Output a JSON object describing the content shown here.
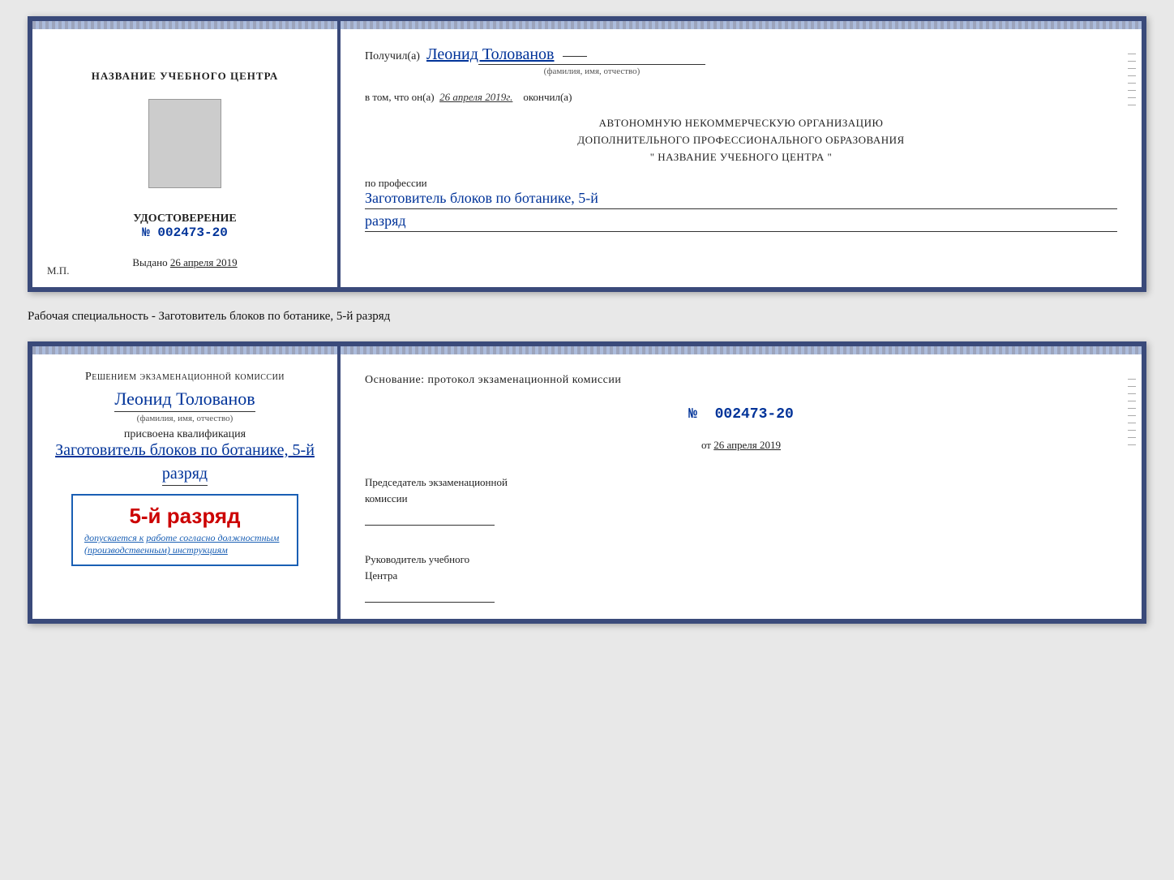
{
  "doc1": {
    "left": {
      "center_title": "НАЗВАНИЕ УЧЕБНОГО ЦЕНТРА",
      "udostoverenie_label": "УДОСТОВЕРЕНИЕ",
      "number_prefix": "№",
      "number": "002473-20",
      "vydano_label": "Выдано",
      "vydano_date": "26 апреля 2019",
      "mp_label": "М.П."
    },
    "right": {
      "poluchil_prefix": "Получил(а)",
      "recipient_name": "Леонид Толованов",
      "fio_hint": "(фамилия, имя, отчество)",
      "vtom_prefix": "в том, что он(а)",
      "vtom_date": "26 апреля 2019г.",
      "okonchil": "окончил(а)",
      "avtonomnuyu_line1": "АВТОНОМНУЮ НЕКОММЕРЧЕСКУЮ ОРГАНИЗАЦИЮ",
      "avtonomnuyu_line2": "ДОПОЛНИТЕЛЬНОГО ПРОФЕССИОНАЛЬНОГО ОБРАЗОВАНИЯ",
      "nazvanie_label": "\" НАЗВАНИЕ УЧЕБНОГО ЦЕНТРА \"",
      "po_professii": "по профессии",
      "profession": "Заготовитель блоков по ботанике, 5-й",
      "razryad": "разряд"
    }
  },
  "specialty_label": "Рабочая специальность - Заготовитель блоков по ботанике, 5-й разряд",
  "doc2": {
    "left": {
      "resheniem_label": "Решением экзаменационной комиссии",
      "recipient_name": "Леонид Толованов",
      "fio_hint": "(фамилия, имя, отчество)",
      "prisvoena": "присвоена квалификация",
      "profession": "Заготовитель блоков по ботанике, 5-й",
      "razryad": "разряд",
      "stamp_razryad": "5-й разряд",
      "dopuskaetsya_prefix": "допускается к",
      "dopuskaetsya_text": "работе согласно должностным",
      "instruktsii": "(производственным) инструкциям"
    },
    "right": {
      "osnovanie_label": "Основание: протокол экзаменационной комиссии",
      "number_prefix": "№",
      "number": "002473-20",
      "ot_prefix": "от",
      "ot_date": "26 апреля 2019",
      "chairman_label": "Председатель экзаменационной",
      "chairman_label2": "комиссии",
      "rukovoditel_label": "Руководитель учебного",
      "rukovoditel_label2": "Центра"
    }
  }
}
